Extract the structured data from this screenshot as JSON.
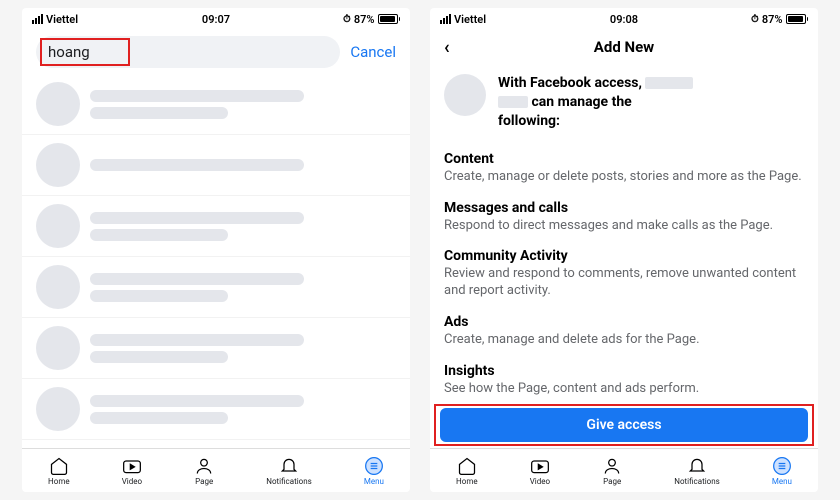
{
  "status": {
    "carrier": "Viettel",
    "time_left": "09:07",
    "time_right": "09:08",
    "battery_pct": "87%"
  },
  "left": {
    "search_value": "hoang",
    "cancel": "Cancel"
  },
  "right": {
    "title": "Add New",
    "intro_1": "With Facebook access,",
    "intro_2": "can manage the",
    "intro_3": "following:",
    "sections": [
      {
        "title": "Content",
        "body": "Create, manage or delete posts, stories and more as the Page."
      },
      {
        "title": "Messages and calls",
        "body": "Respond to direct messages and make calls as the Page."
      },
      {
        "title": "Community Activity",
        "body": "Review and respond to comments, remove unwanted content and report activity."
      },
      {
        "title": "Ads",
        "body": "Create, manage and delete ads for the Page."
      },
      {
        "title": "Insights",
        "body": "See how the Page, content and ads perform."
      }
    ],
    "button": "Give access"
  },
  "tabs": [
    "Home",
    "Video",
    "Page",
    "Notifications",
    "Menu"
  ]
}
